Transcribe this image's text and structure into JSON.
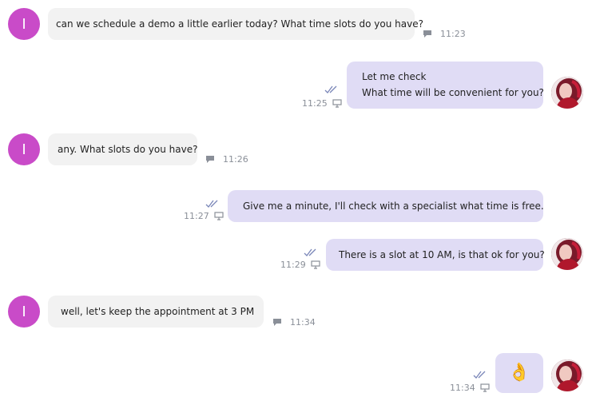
{
  "messages": [
    {
      "direction": "in",
      "avatar_letter": "I",
      "text": [
        "can we schedule a demo a little earlier today? What time slots do you have?"
      ],
      "time": "11:23",
      "meta_icon": "comment-icon"
    },
    {
      "direction": "out",
      "text": [
        "Let me check",
        "What time will be convenient for you?"
      ],
      "time": "11:25",
      "meta_icon": "monitor-icon",
      "status_icon": "double-check-icon"
    },
    {
      "direction": "in",
      "avatar_letter": "I",
      "text": [
        "any. What slots do you have?"
      ],
      "time": "11:26",
      "meta_icon": "comment-icon"
    },
    {
      "direction": "out",
      "text": [
        "Give me a minute, I'll check with a specialist what time is free."
      ],
      "time": "11:27",
      "meta_icon": "monitor-icon",
      "status_icon": "double-check-icon"
    },
    {
      "direction": "out",
      "text": [
        "There is a slot at 10 AM, is that ok for you?"
      ],
      "time": "11:29",
      "meta_icon": "monitor-icon",
      "status_icon": "double-check-icon"
    },
    {
      "direction": "in",
      "avatar_letter": "I",
      "text": [
        "well, let's keep the appointment at 3 PM"
      ],
      "time": "11:34",
      "meta_icon": "comment-icon"
    },
    {
      "direction": "out",
      "text": [
        "👌"
      ],
      "time": "11:34",
      "meta_icon": "monitor-icon",
      "status_icon": "double-check-icon"
    }
  ],
  "colors": {
    "incoming_avatar": "#c94bc8",
    "incoming_bubble": "#f2f2f2",
    "outgoing_bubble": "#e0dcf5",
    "meta_text": "#8a8f98",
    "check_color": "#7a86b8"
  }
}
